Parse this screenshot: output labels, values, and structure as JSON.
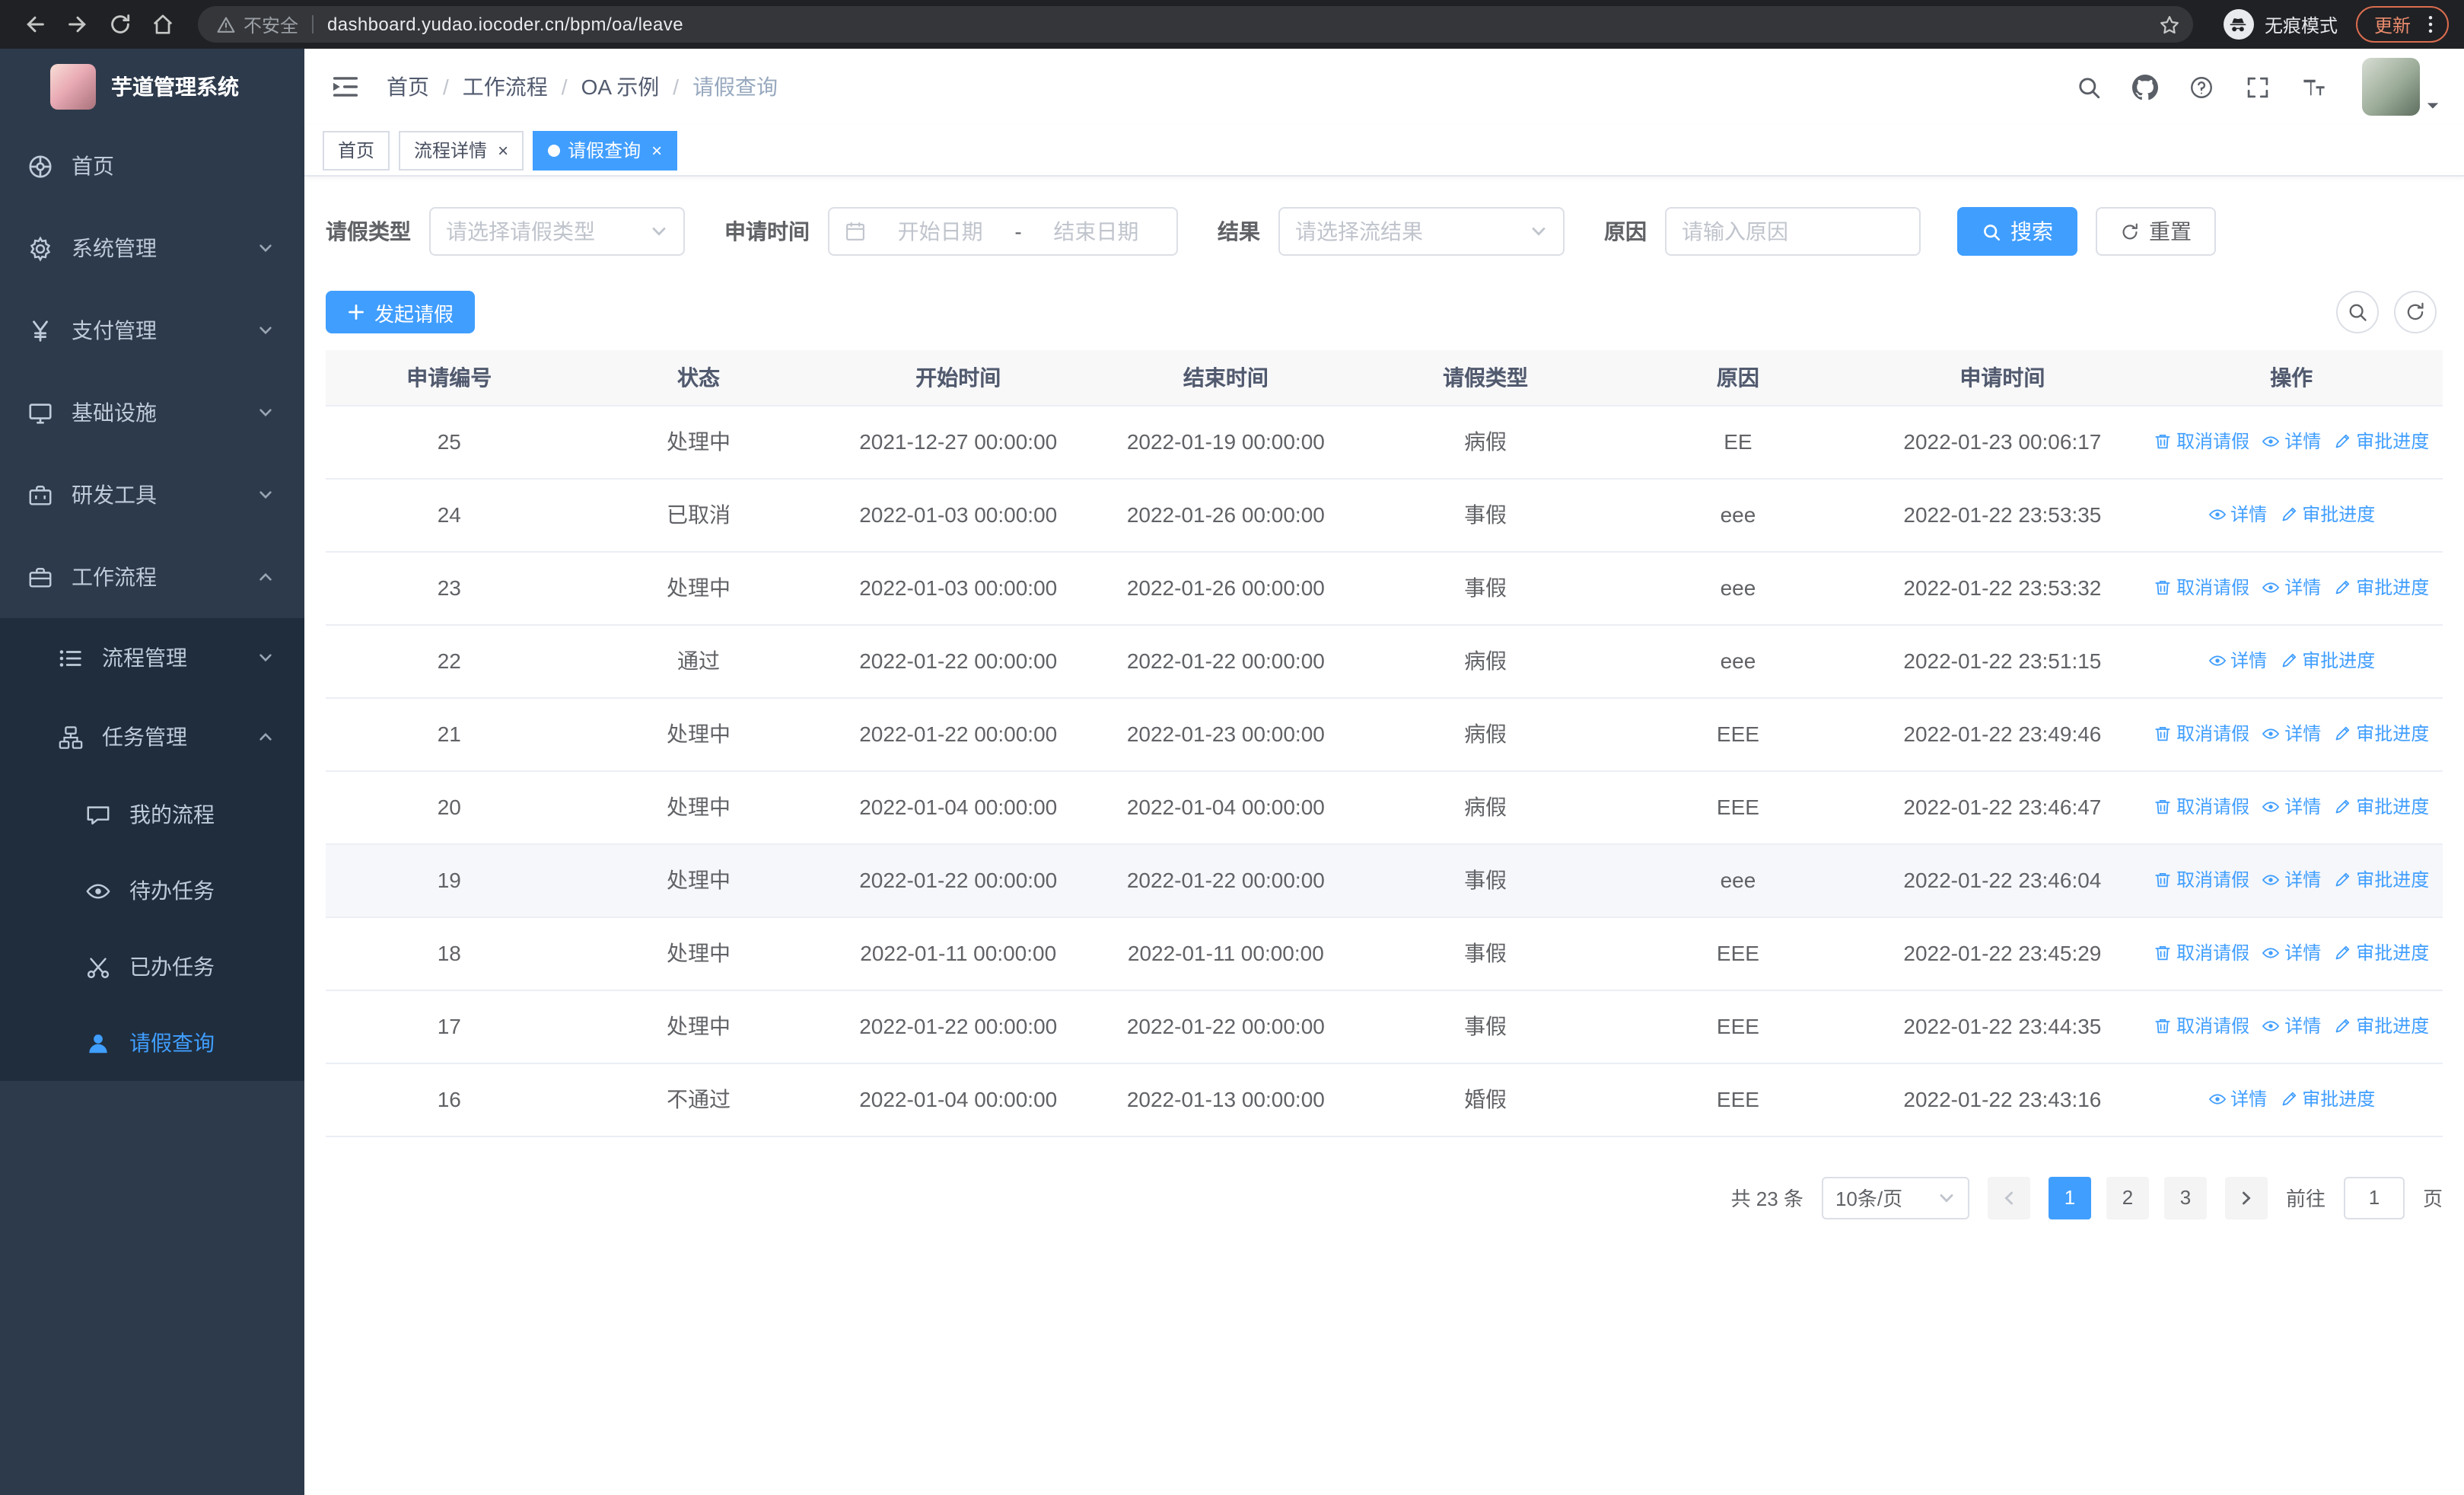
{
  "theme": {
    "primary": "#409eff",
    "sidebar_bg": "#2d3a4b",
    "sidebar_submenu_bg": "#1f2d3d",
    "sidebar_text": "#bfcbd9",
    "hover_row_bg": "#f5f7fa"
  },
  "browser": {
    "security_warning": "不安全",
    "url": "dashboard.yudao.iocoder.cn/bpm/oa/leave",
    "incognito_label": "无痕模式",
    "update_label": "更新"
  },
  "sidebar": {
    "logo_title": "芋道管理系统",
    "items": [
      {
        "label": "首页",
        "icon": "dashboard-icon",
        "level": 1
      },
      {
        "label": "系统管理",
        "icon": "gear-icon",
        "level": 1,
        "arrow": "down"
      },
      {
        "label": "支付管理",
        "icon": "payment-icon",
        "level": 1,
        "arrow": "down"
      },
      {
        "label": "基础设施",
        "icon": "infrastructure-icon",
        "level": 1,
        "arrow": "down"
      },
      {
        "label": "研发工具",
        "icon": "devtools-icon",
        "level": 1,
        "arrow": "down"
      },
      {
        "label": "工作流程",
        "icon": "workflow-icon",
        "level": 1,
        "arrow": "up"
      },
      {
        "label": "流程管理",
        "icon": "process-icon",
        "level": 2,
        "arrow": "down",
        "dark": true
      },
      {
        "label": "任务管理",
        "icon": "task-icon",
        "level": 2,
        "arrow": "up",
        "dark": true
      },
      {
        "label": "我的流程",
        "icon": "my-process-icon",
        "level": 3,
        "dark": true
      },
      {
        "label": "待办任务",
        "icon": "todo-icon",
        "level": 3,
        "dark": true
      },
      {
        "label": "已办任务",
        "icon": "done-icon",
        "level": 3,
        "dark": true
      },
      {
        "label": "请假查询",
        "icon": "leave-query-icon",
        "level": 3,
        "dark": true,
        "active": true
      }
    ]
  },
  "navbar": {
    "breadcrumb": [
      "首页",
      "工作流程",
      "OA 示例",
      "请假查询"
    ],
    "breadcrumb_separator": "/"
  },
  "tabs": [
    {
      "label": "首页",
      "closable": false,
      "active": false
    },
    {
      "label": "流程详情",
      "closable": true,
      "active": false
    },
    {
      "label": "请假查询",
      "closable": true,
      "active": true
    }
  ],
  "filters": {
    "leave_type": {
      "label": "请假类型",
      "placeholder": "请选择请假类型"
    },
    "apply_time": {
      "label": "申请时间",
      "start_placeholder": "开始日期",
      "separator": "-",
      "end_placeholder": "结束日期"
    },
    "result": {
      "label": "结果",
      "placeholder": "请选择流结果"
    },
    "reason": {
      "label": "原因",
      "placeholder": "请输入原因"
    },
    "search_label": "搜索",
    "reset_label": "重置"
  },
  "toolbar": {
    "create_label": "发起请假"
  },
  "table": {
    "headers": [
      "申请编号",
      "状态",
      "开始时间",
      "结束时间",
      "请假类型",
      "原因",
      "申请时间",
      "操作"
    ],
    "action_labels": {
      "cancel": "取消请假",
      "detail": "详情",
      "progress": "审批进度"
    },
    "rows": [
      {
        "id": "25",
        "status": "处理中",
        "start_time": "2021-12-27 00:00:00",
        "end_time": "2022-01-19 00:00:00",
        "leave_type": "病假",
        "reason": "EE",
        "apply_time": "2022-01-23 00:06:17",
        "cancellable": true
      },
      {
        "id": "24",
        "status": "已取消",
        "start_time": "2022-01-03 00:00:00",
        "end_time": "2022-01-26 00:00:00",
        "leave_type": "事假",
        "reason": "eee",
        "apply_time": "2022-01-22 23:53:35",
        "cancellable": false
      },
      {
        "id": "23",
        "status": "处理中",
        "start_time": "2022-01-03 00:00:00",
        "end_time": "2022-01-26 00:00:00",
        "leave_type": "事假",
        "reason": "eee",
        "apply_time": "2022-01-22 23:53:32",
        "cancellable": true
      },
      {
        "id": "22",
        "status": "通过",
        "start_time": "2022-01-22 00:00:00",
        "end_time": "2022-01-22 00:00:00",
        "leave_type": "病假",
        "reason": "eee",
        "apply_time": "2022-01-22 23:51:15",
        "cancellable": false
      },
      {
        "id": "21",
        "status": "处理中",
        "start_time": "2022-01-22 00:00:00",
        "end_time": "2022-01-23 00:00:00",
        "leave_type": "病假",
        "reason": "EEE",
        "apply_time": "2022-01-22 23:49:46",
        "cancellable": true
      },
      {
        "id": "20",
        "status": "处理中",
        "start_time": "2022-01-04 00:00:00",
        "end_time": "2022-01-04 00:00:00",
        "leave_type": "病假",
        "reason": "EEE",
        "apply_time": "2022-01-22 23:46:47",
        "cancellable": true
      },
      {
        "id": "19",
        "status": "处理中",
        "start_time": "2022-01-22 00:00:00",
        "end_time": "2022-01-22 00:00:00",
        "leave_type": "事假",
        "reason": "eee",
        "apply_time": "2022-01-22 23:46:04",
        "cancellable": true,
        "hover": true
      },
      {
        "id": "18",
        "status": "处理中",
        "start_time": "2022-01-11 00:00:00",
        "end_time": "2022-01-11 00:00:00",
        "leave_type": "事假",
        "reason": "EEE",
        "apply_time": "2022-01-22 23:45:29",
        "cancellable": true
      },
      {
        "id": "17",
        "status": "处理中",
        "start_time": "2022-01-22 00:00:00",
        "end_time": "2022-01-22 00:00:00",
        "leave_type": "事假",
        "reason": "EEE",
        "apply_time": "2022-01-22 23:44:35",
        "cancellable": true
      },
      {
        "id": "16",
        "status": "不通过",
        "start_time": "2022-01-04 00:00:00",
        "end_time": "2022-01-13 00:00:00",
        "leave_type": "婚假",
        "reason": "EEE",
        "apply_time": "2022-01-22 23:43:16",
        "cancellable": false
      }
    ]
  },
  "pagination": {
    "total": "共 23 条",
    "page_size": "10条/页",
    "pages": [
      "1",
      "2",
      "3"
    ],
    "active_page": "1",
    "goto_prefix": "前往",
    "goto_value": "1",
    "goto_suffix": "页"
  }
}
